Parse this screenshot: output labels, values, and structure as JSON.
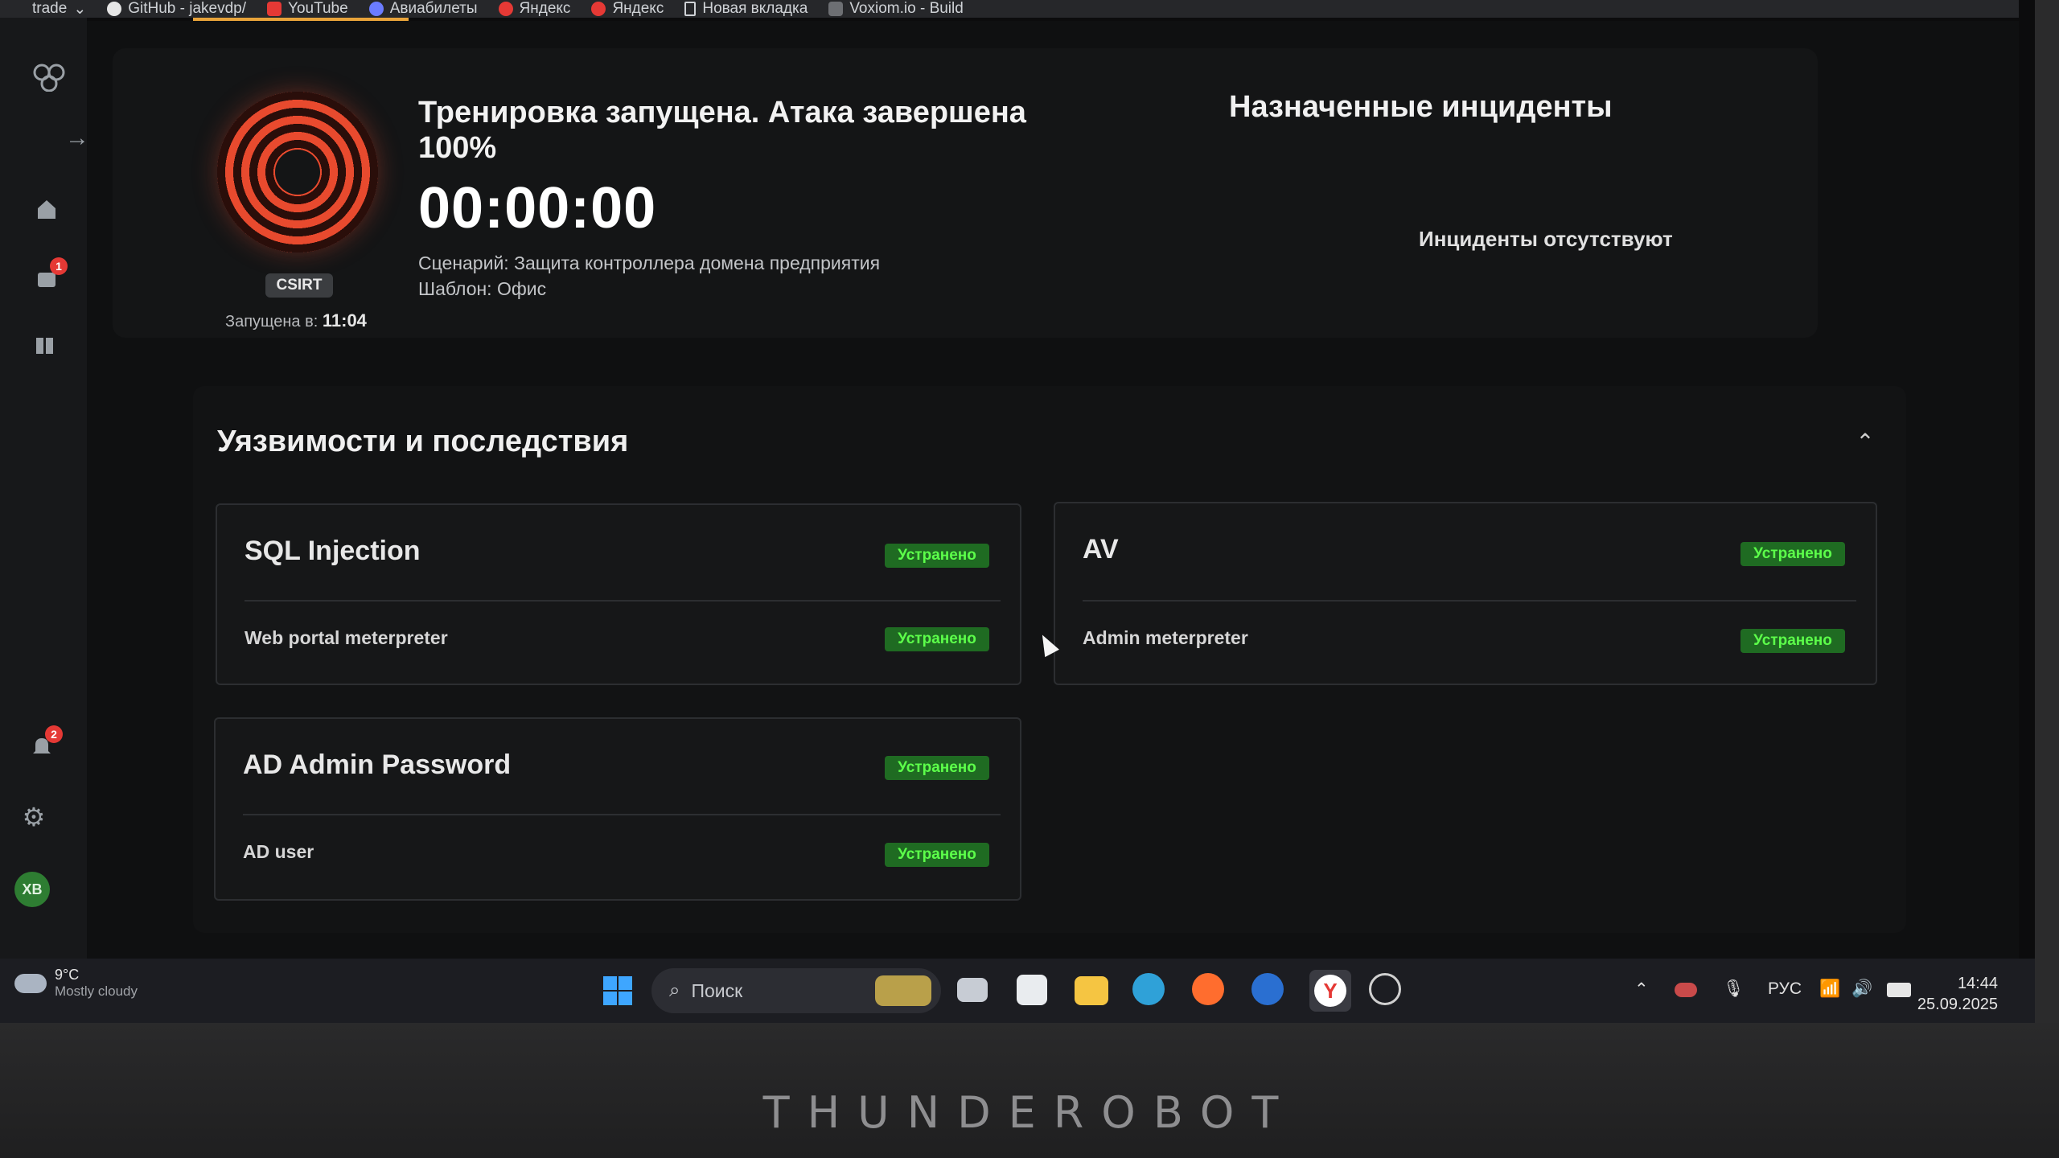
{
  "bookmarks": [
    "trade",
    "GitHub - jakevdp/",
    "YouTube",
    "Авиабилеты",
    "Яндекс",
    "Яндекс",
    "Новая вкладка",
    "Voxiom.io - Build"
  ],
  "sidebar": {
    "notifications_badge_1": "1",
    "notifications_badge_2": "2",
    "avatar_initials": "ХВ"
  },
  "training": {
    "status": "Тренировка запущена. Атака завершена 100%",
    "timer": "00:00:00",
    "team": "CSIRT",
    "started_label": "Запущена в:",
    "started_time": "11:04",
    "scenario": "Сценарий: Защита контроллера домена предприятия",
    "template": "Шаблон: Офис"
  },
  "incidents": {
    "title": "Назначенные инциденты",
    "empty": "Инциденты отсутствуют"
  },
  "vulnerabilities": {
    "title": "Уязвимости и последствия",
    "cards": [
      {
        "name": "SQL Injection",
        "status": "Устранено",
        "consequence": "Web portal meterpreter",
        "consequence_status": "Устранено"
      },
      {
        "name": "AV",
        "status": "Устранено",
        "consequence": "Admin meterpreter",
        "consequence_status": "Устранено"
      },
      {
        "name": "AD Admin Password",
        "status": "Устранено",
        "consequence": "AD user",
        "consequence_status": "Устранено"
      }
    ]
  },
  "taskbar": {
    "temperature": "9°C",
    "weather": "Mostly cloudy",
    "search_placeholder": "Поиск",
    "language": "РУС",
    "time": "14:44",
    "date": "25.09.2025"
  },
  "bezel_brand": "THUNDEROBOT",
  "colors": {
    "accent_red": "#e84a2e",
    "status_green": "#5cff4a",
    "bookmark_underline": "#e8a33a"
  }
}
